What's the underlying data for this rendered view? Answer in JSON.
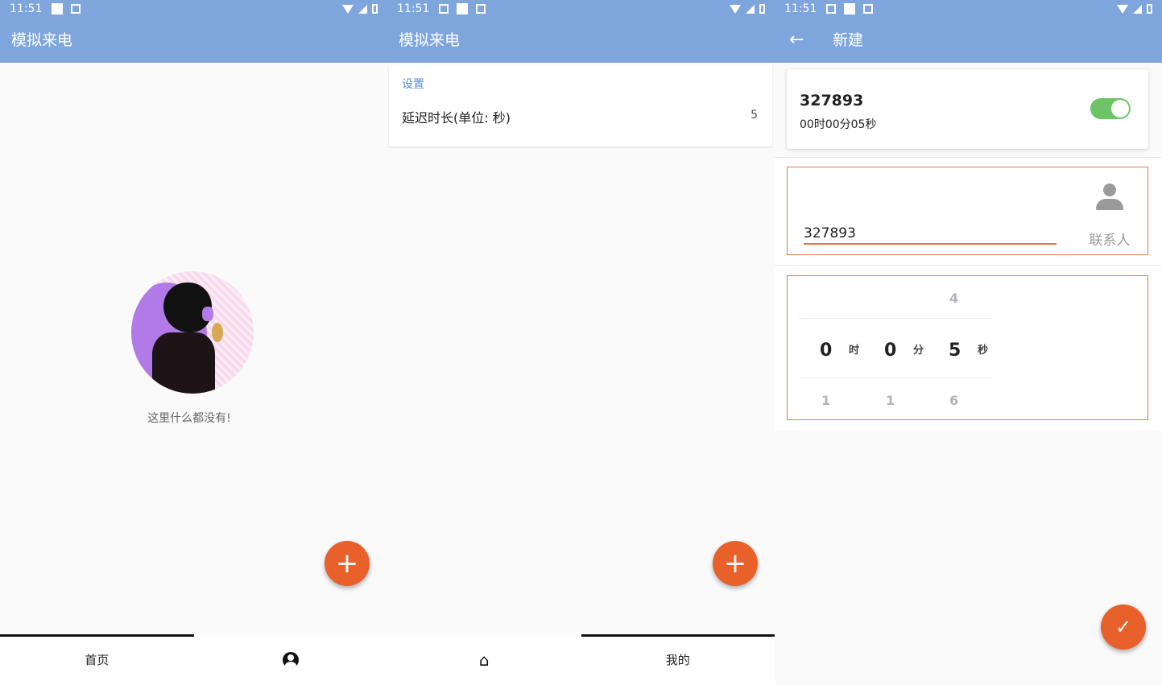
{
  "status_bar": {
    "time": "11:51"
  },
  "screen_home": {
    "title": "模拟来电",
    "empty_text": "这里什么都没有!",
    "fab_symbol": "+",
    "nav": {
      "tab_home": "首页",
      "tab_mine_icon": "account-circle-icon"
    }
  },
  "screen_settings": {
    "title": "模拟来电",
    "section_header": "设置",
    "delay_label": "延迟时长(单位: 秒)",
    "delay_value": "5",
    "fab_symbol": "+",
    "nav": {
      "tab_home_icon": "home-icon",
      "tab_mine": "我的"
    }
  },
  "screen_new": {
    "title": "新建",
    "back_symbol": "←",
    "entry": {
      "number": "327893",
      "duration": "00时00分05秒",
      "enabled": true
    },
    "phone_input_value": "327893",
    "contact_label": "联系人",
    "picker": {
      "hours": {
        "above": "",
        "selected": "0",
        "below": "1",
        "unit": "时"
      },
      "minutes": {
        "above": "",
        "selected": "0",
        "below": "1",
        "unit": "分"
      },
      "seconds": {
        "above": "4",
        "selected": "5",
        "below": "6",
        "unit": "秒"
      }
    },
    "confirm_symbol": "✓"
  },
  "colors": {
    "appbar": "#7fa6dc",
    "accent": "#e8612b",
    "switch_on": "#6cc466",
    "section_header": "#5c8fd6"
  }
}
